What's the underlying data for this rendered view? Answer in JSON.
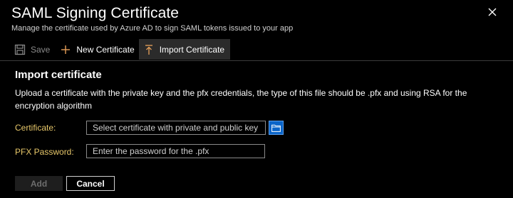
{
  "header": {
    "title": "SAML Signing Certificate",
    "subtitle": "Manage the certificate used by Azure AD to sign SAML tokens issued to your app"
  },
  "toolbar": {
    "save_label": "Save",
    "new_certificate_label": "New Certificate",
    "import_certificate_label": "Import Certificate"
  },
  "import": {
    "section_title": "Import certificate",
    "description": "Upload a certificate with the private key and the pfx credentials, the type of this file should be .pfx and using RSA for the encryption algorithm",
    "certificate_label": "Certificate:",
    "certificate_placeholder": "Select certificate with private and public key",
    "pfx_label": "PFX Password:",
    "pfx_placeholder": "Enter the password for the .pfx"
  },
  "actions": {
    "add_label": "Add",
    "cancel_label": "Cancel"
  },
  "icons": {
    "close": "close-icon",
    "save": "save-icon",
    "new_certificate": "plus-icon",
    "import_certificate": "upload-icon",
    "browse": "folder-icon"
  },
  "colors": {
    "background": "#000000",
    "label": "#e8c86a",
    "accent": "#0a64c8",
    "import_icon": "#e8a15a",
    "plus_icon": "#e8a15a"
  }
}
